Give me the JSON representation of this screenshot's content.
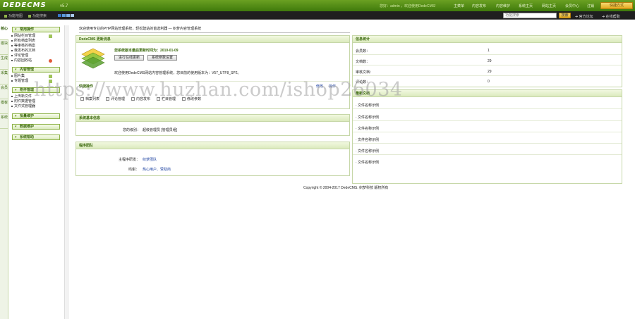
{
  "header": {
    "logo": "DEDECMS",
    "version": "v5.7",
    "welcome": "您好：admin ，欢迎使用DedeCMS!",
    "nav": [
      "主菜单",
      "内容发布",
      "内容维护",
      "系统主页",
      "网站主页",
      "会员中心",
      "注销"
    ],
    "quick_button": "快捷方式"
  },
  "subbar": {
    "tabs": [
      "功能地图",
      "功能搜索"
    ],
    "swatch_colors": [
      "#3a76c8",
      "#5d9ade",
      "#7fb2e8",
      "#a9c9ee"
    ],
    "search_placeholder": "功能搜索",
    "search_button": "搜索",
    "links": [
      "官方论坛",
      "在线帮助"
    ]
  },
  "sidetabs": [
    "核心",
    "模块",
    "生成",
    "采集",
    "会员",
    "模板",
    "系统"
  ],
  "menu": {
    "sections": [
      {
        "title": "常用操作",
        "items": [
          "网站栏目管理",
          "所有档案列表",
          "等审核的档案",
          "我发布的文档",
          "评论管理",
          "内容回收站"
        ]
      },
      {
        "title": "内容管理",
        "items": [
          "图片集",
          "专题管理"
        ]
      },
      {
        "title": "附件管理",
        "items": [
          "上传新文件",
          "附件数据管理",
          "文件式管理器"
        ]
      },
      {
        "title": "批量维护"
      },
      {
        "title": "数据维护"
      },
      {
        "title": "系统帮助"
      }
    ]
  },
  "content": {
    "welcome_msg": "欢迎使用专业的PHP网站管理系统，轻松建站的首选利器 — 织梦内容管理系统",
    "news_panel": {
      "title": "DedeCMS 更新消息",
      "update_label": "您系统版本最后更新时间为：2010-01-09",
      "btn_update": "进行在线更新",
      "btn_config": "系统参数设置",
      "version_text": "欢迎使用DedeCMS网站内容管理系统，您目前的使用版本为：V57_UTF8_SP2。"
    },
    "quick_panel": {
      "title": "快捷操作",
      "right_links": [
        "修改",
        "操作"
      ],
      "items": [
        "档案列表",
        "评论管理",
        "内容发布",
        "栏目管理",
        "修改参数"
      ]
    },
    "sysinfo_panel": {
      "title": "系统基本信息",
      "label": "您的级别：",
      "value": "超级管理员 [管理员组]"
    },
    "team_panel": {
      "title": "程序团队",
      "row1_label": "主程序研发：",
      "row1_value": "织梦团队",
      "row2_label": "鸣谢：",
      "row2_value": "热心用户、赞助商"
    },
    "stats_panel": {
      "title": "信息统计",
      "rows": [
        {
          "label": "会员数：",
          "value": "1"
        },
        {
          "label": "文档数：",
          "value": "29"
        },
        {
          "label": "审核文档：",
          "value": "29"
        },
        {
          "label": "评论数：",
          "value": "0"
        }
      ]
    },
    "latest_panel": {
      "title": "最新文档",
      "items": [
        "· 文件名称示例",
        "· 文件名称示例",
        "· 文件名称示例",
        "· 文件名称示例",
        "· 文件名称示例",
        "· 文件名称示例"
      ]
    },
    "copyright": "Copyright © 2004-2017 DedeCMS. 织梦科技 版权所有"
  },
  "watermark": "https://www.huzhan.com/ishop26034"
}
